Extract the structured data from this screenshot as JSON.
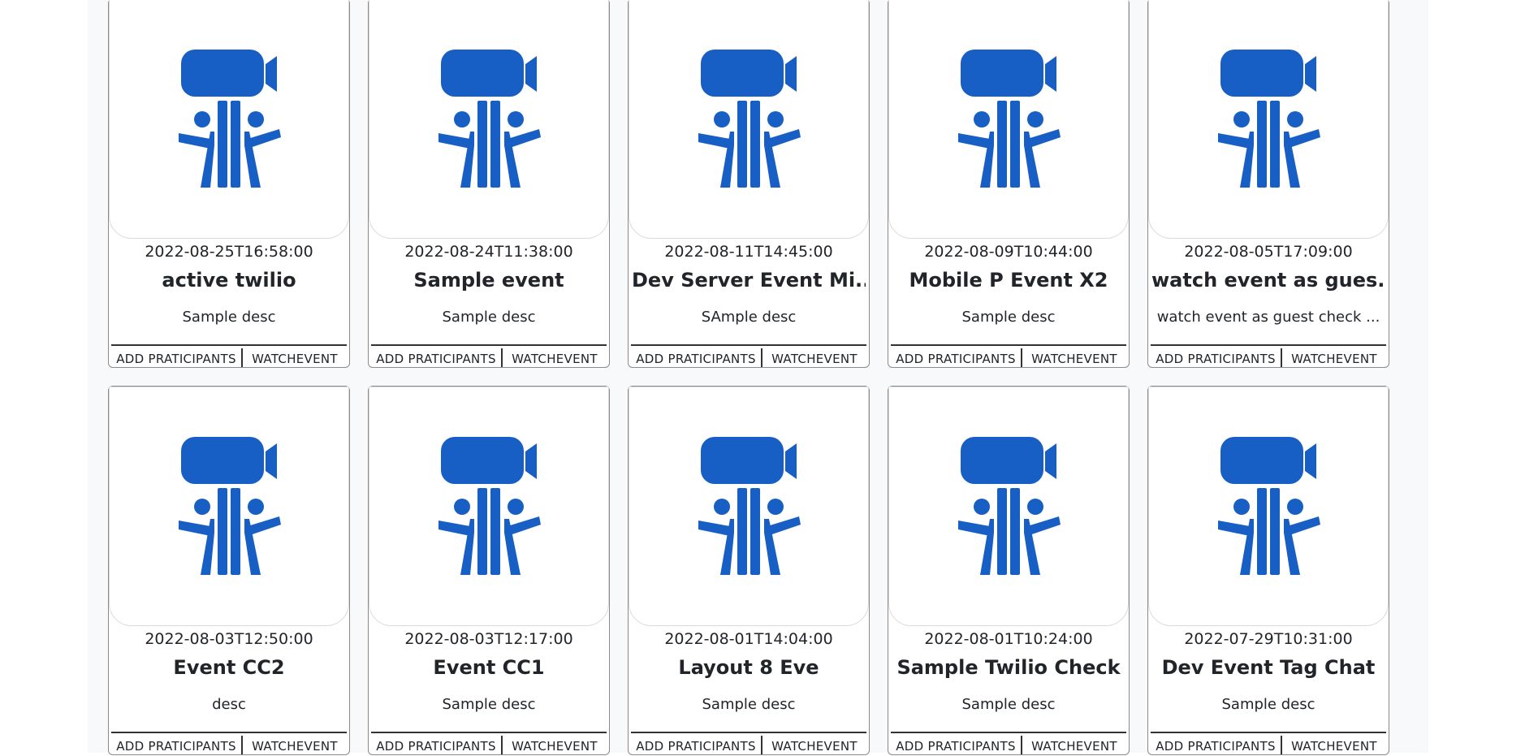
{
  "events": [
    {
      "date": "2022-08-25T16:58:00",
      "title": "active twilio",
      "desc": "Sample desc"
    },
    {
      "date": "2022-08-24T11:38:00",
      "title": "Sample event",
      "desc": "Sample desc"
    },
    {
      "date": "2022-08-11T14:45:00",
      "title": "Dev Server Event Mi...",
      "desc": "SAmple desc"
    },
    {
      "date": "2022-08-09T10:44:00",
      "title": "Mobile P Event X2",
      "desc": "Sample desc"
    },
    {
      "date": "2022-08-05T17:09:00",
      "title": "watch event as gues...",
      "desc": "watch event as guest check ..."
    },
    {
      "date": "2022-08-03T12:50:00",
      "title": "Event CC2",
      "desc": "desc"
    },
    {
      "date": "2022-08-03T12:17:00",
      "title": "Event CC1",
      "desc": "Sample desc"
    },
    {
      "date": "2022-08-01T14:04:00",
      "title": "Layout 8 Eve",
      "desc": "Sample desc"
    },
    {
      "date": "2022-08-01T10:24:00",
      "title": "Sample Twilio Check",
      "desc": "Sample desc"
    },
    {
      "date": "2022-07-29T10:31:00",
      "title": "Dev Event Tag Chat",
      "desc": "Sample desc"
    }
  ],
  "actions": {
    "add_label": "ADD PRATICIPANTS",
    "watch_label": "WATCHEVENT"
  },
  "theme": {
    "icon_color": "#175ec5",
    "icon_name": "video-event-icon"
  }
}
